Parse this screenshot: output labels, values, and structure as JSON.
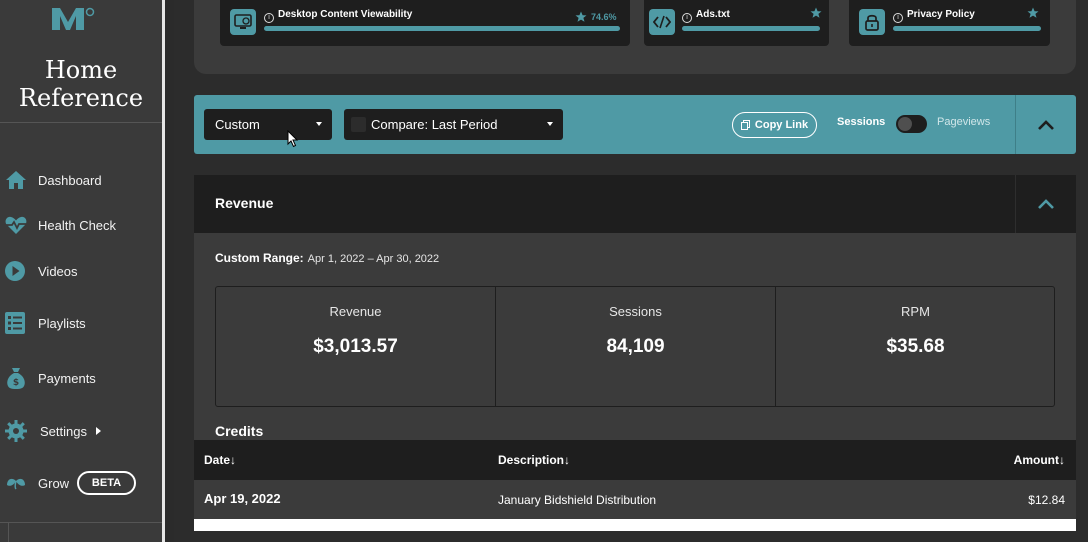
{
  "sidebar": {
    "site_name_line1": "Home",
    "site_name_line2": "Reference",
    "items": [
      {
        "label": "Dashboard",
        "icon": "home-icon"
      },
      {
        "label": "Health Check",
        "icon": "heart-pulse-icon"
      },
      {
        "label": "Videos",
        "icon": "play-circle-icon"
      },
      {
        "label": "Playlists",
        "icon": "list-icon"
      },
      {
        "label": "Payments",
        "icon": "money-bag-icon"
      },
      {
        "label": "Settings",
        "icon": "gear-icon"
      },
      {
        "label": "Grow",
        "icon": "leaf-icon",
        "badge": "BETA"
      }
    ]
  },
  "health_cards": [
    {
      "title": "Desktop Content Viewability",
      "value": "74.6%",
      "icon": "monitor-icon"
    },
    {
      "title": "Ads.txt",
      "icon": "code-icon"
    },
    {
      "title": "Privacy Policy",
      "icon": "lock-icon"
    }
  ],
  "toolbar": {
    "date_select": "Custom",
    "compare_select": "Compare: Last Period",
    "copy_link": "Copy Link",
    "toggle_left": "Sessions",
    "toggle_right": "Pageviews"
  },
  "revenue": {
    "title": "Revenue",
    "range_label": "Custom Range:",
    "range_value": "Apr 1, 2022 – Apr 30, 2022",
    "metrics": [
      {
        "label": "Revenue",
        "value": "$3,013.57"
      },
      {
        "label": "Sessions",
        "value": "84,109"
      },
      {
        "label": "RPM",
        "value": "$35.68"
      }
    ]
  },
  "credits": {
    "title": "Credits",
    "columns": [
      "Date↓",
      "Description↓",
      "Amount↓"
    ],
    "rows": [
      {
        "date": "Apr 19, 2022",
        "description": "January Bidshield Distribution",
        "amount": "$12.84"
      }
    ]
  },
  "colors": {
    "accent": "#4f9aa5",
    "sidebar_bg": "#3a3a3a",
    "panel_dark": "#1e1e1e"
  }
}
